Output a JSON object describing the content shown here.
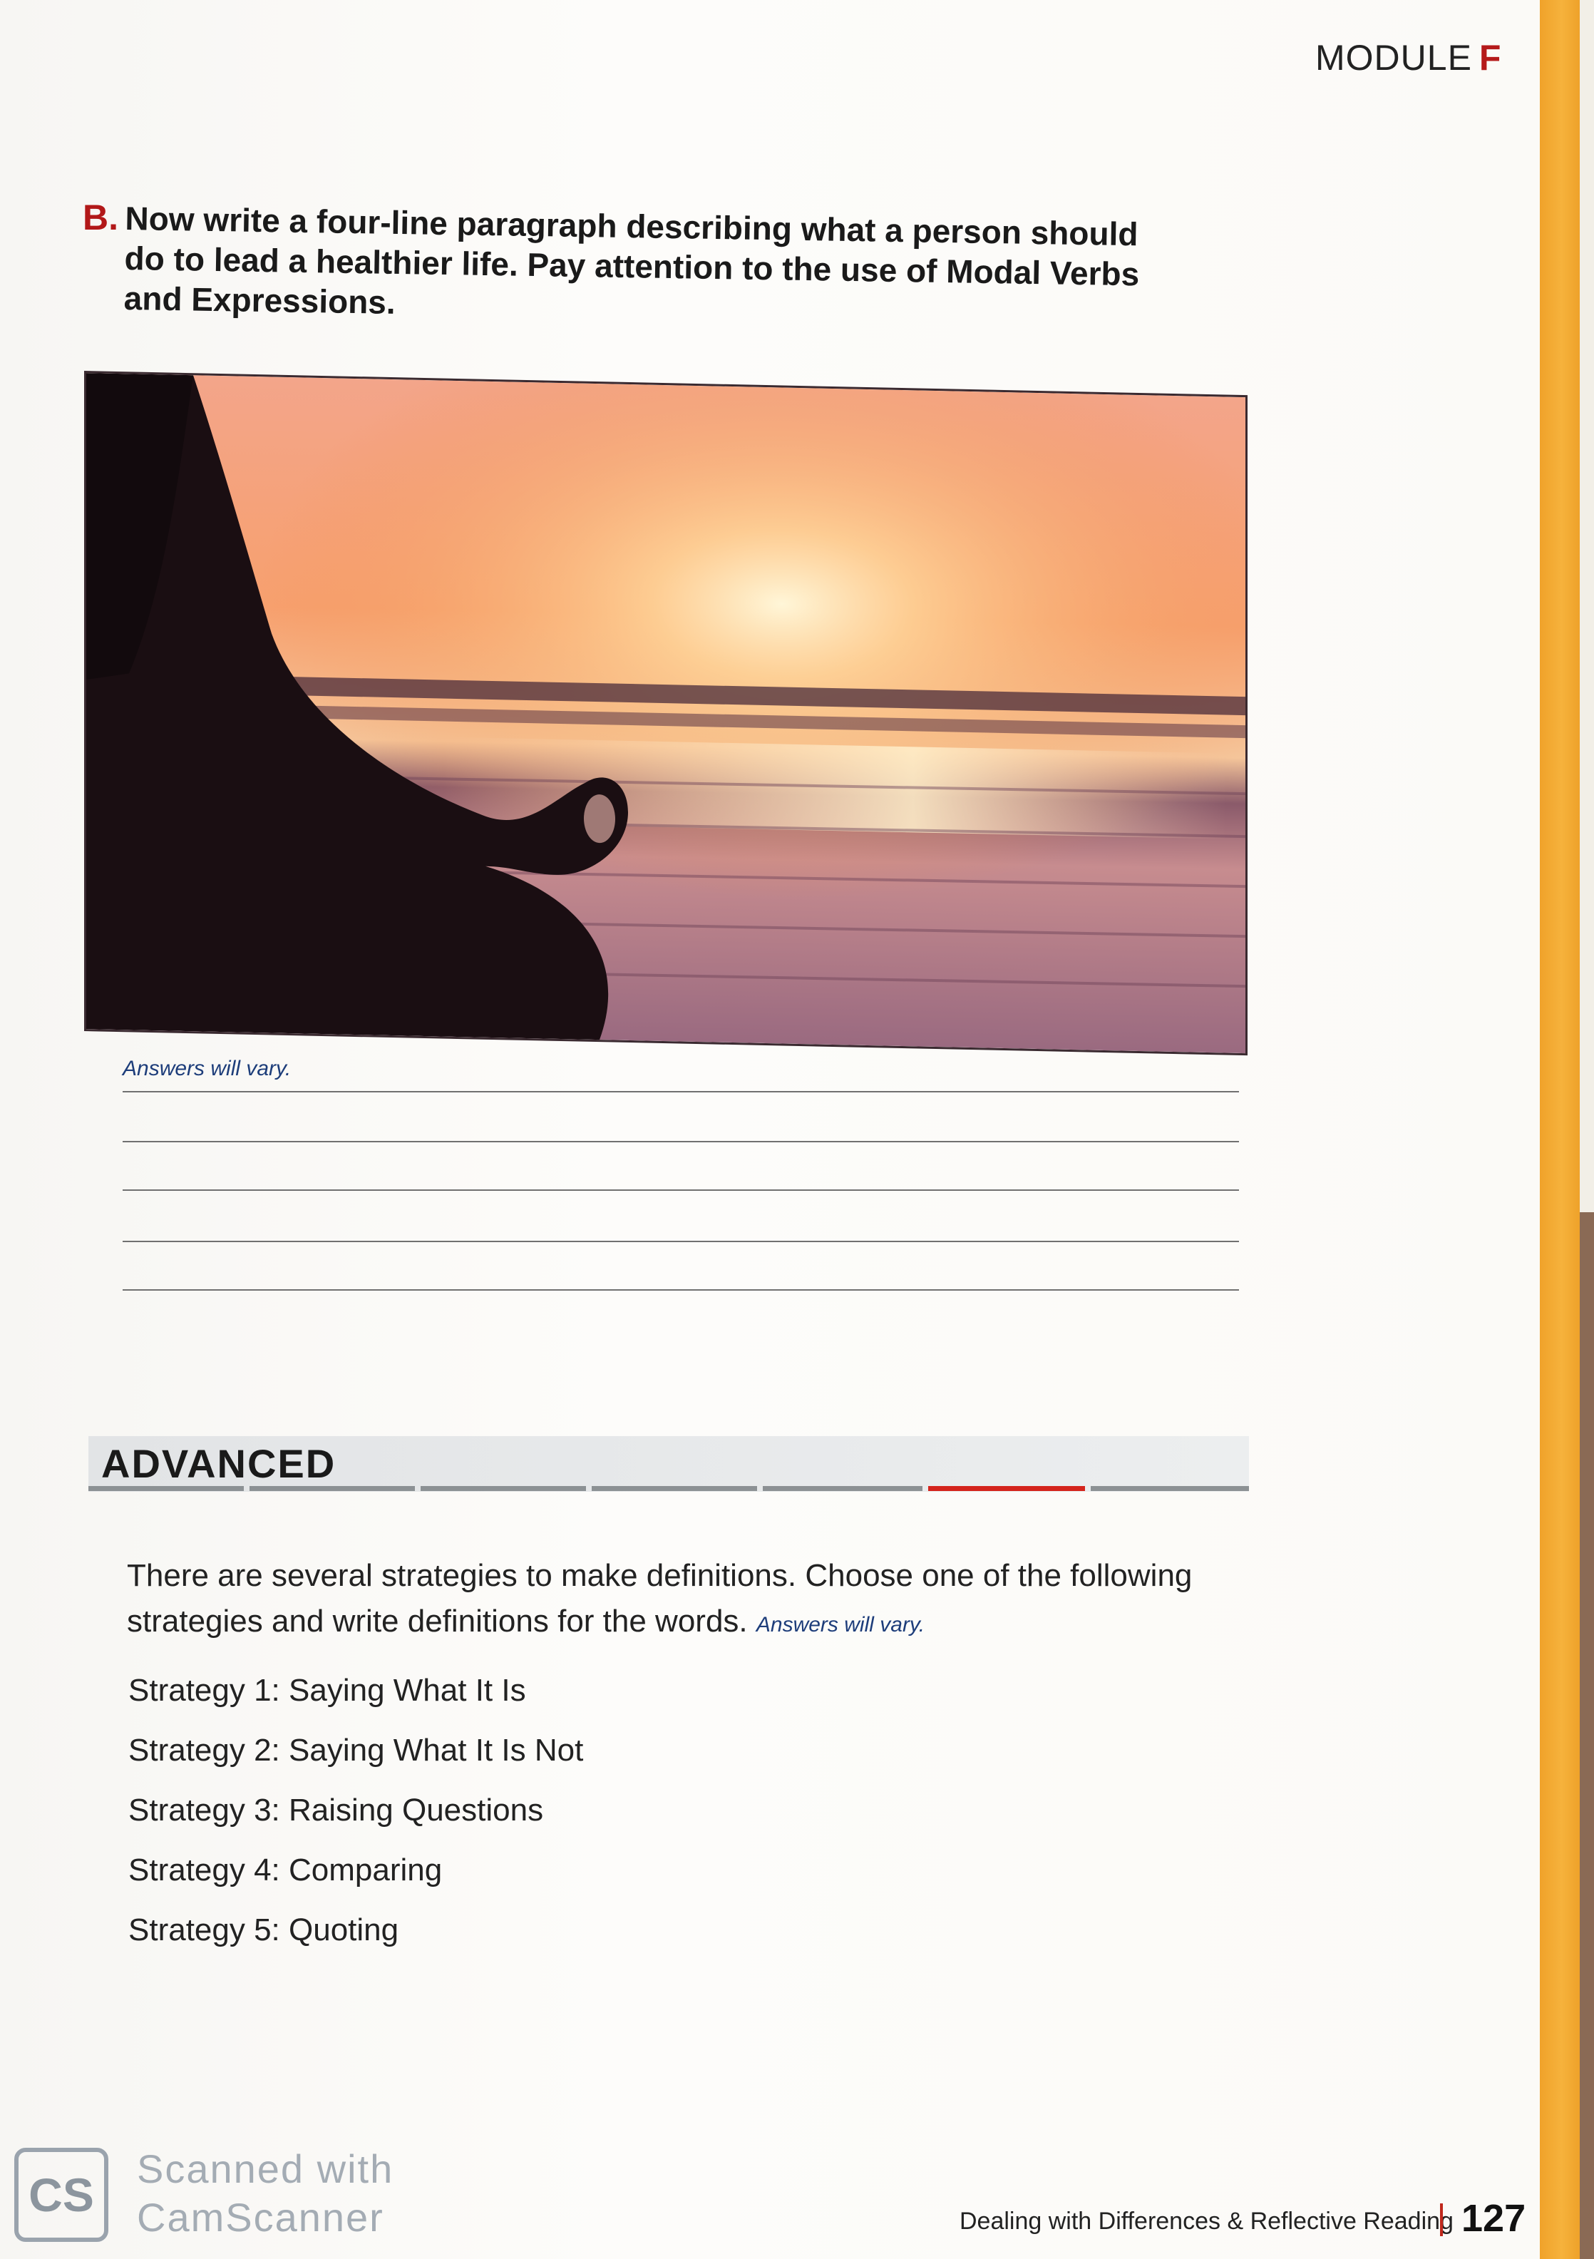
{
  "header": {
    "module_label": "MODULE",
    "module_letter": "F"
  },
  "exercise_b": {
    "letter": "B.",
    "instruction": "Now write a four-line paragraph describing what a person should do to lead a healthier life. Pay attention to the use of Modal Verbs and Expressions.",
    "answer_note": "Answers will vary.",
    "answer_line_count": 5
  },
  "photo": {
    "subject": "meditation-silhouette-sunset-sea"
  },
  "advanced": {
    "title": "ADVANCED",
    "intro": "There are several strategies to make definitions. Choose one of the following strategies and write definitions for the words.",
    "answer_note": "Answers will vary.",
    "strategies": [
      {
        "label": "Strategy 1:",
        "text": "Saying What It Is"
      },
      {
        "label": "Strategy 2:",
        "text": "Saying What It Is Not"
      },
      {
        "label": "Strategy 3:",
        "text": "Raising Questions"
      },
      {
        "label": "Strategy 4:",
        "text": "Comparing"
      },
      {
        "label": "Strategy 5:",
        "text": "Quoting"
      }
    ]
  },
  "watermark": {
    "logo": "CS",
    "line1": "Scanned with",
    "line2": "CamScanner"
  },
  "footer": {
    "title": "Dealing with Differences & Reflective Reading",
    "page_number": "127"
  },
  "colors": {
    "accent_red": "#b21818",
    "note_blue": "#1d3d7a",
    "edge_orange": "#f0a22a"
  }
}
